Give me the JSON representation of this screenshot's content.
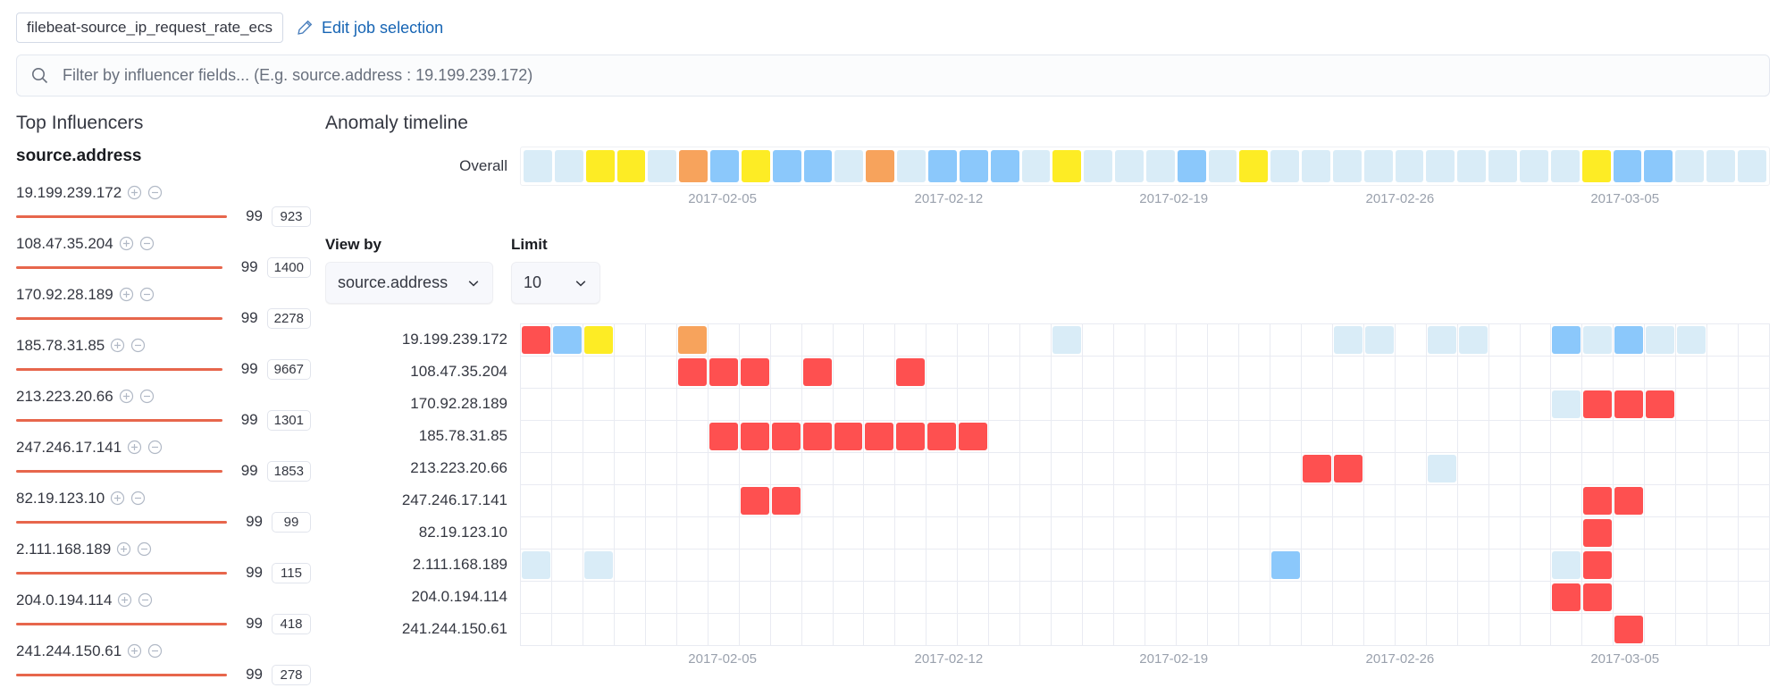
{
  "header": {
    "job_id": "filebeat-source_ip_request_rate_ecs",
    "edit_link": "Edit job selection",
    "pencil_icon": "pencil-icon"
  },
  "search": {
    "placeholder": "Filter by influencer fields... (E.g. source.address : 19.199.239.172)",
    "value": "",
    "icon": "search-icon"
  },
  "influencers_panel": {
    "title": "Top Influencers",
    "field_name": "source.address",
    "add_icon": "plus-circle-icon",
    "remove_icon": "minus-circle-icon",
    "bar_color": "#e7664c",
    "items": [
      {
        "name": "19.199.239.172",
        "score": "99",
        "bar_pct": 100,
        "count": "923"
      },
      {
        "name": "108.47.35.204",
        "score": "99",
        "bar_pct": 100,
        "count": "1400"
      },
      {
        "name": "170.92.28.189",
        "score": "99",
        "bar_pct": 100,
        "count": "2278"
      },
      {
        "name": "185.78.31.85",
        "score": "99",
        "bar_pct": 100,
        "count": "9667"
      },
      {
        "name": "213.223.20.66",
        "score": "99",
        "bar_pct": 100,
        "count": "1301"
      },
      {
        "name": "247.246.17.141",
        "score": "99",
        "bar_pct": 100,
        "count": "1853"
      },
      {
        "name": "82.19.123.10",
        "score": "99",
        "bar_pct": 100,
        "count": "99"
      },
      {
        "name": "2.111.168.189",
        "score": "99",
        "bar_pct": 100,
        "count": "115"
      },
      {
        "name": "204.0.194.114",
        "score": "99",
        "bar_pct": 100,
        "count": "418"
      },
      {
        "name": "241.244.150.61",
        "score": "99",
        "bar_pct": 100,
        "count": "278"
      }
    ]
  },
  "timeline_panel": {
    "title": "Anomaly timeline",
    "overall_label": "Overall"
  },
  "controls": {
    "view_by_label": "View by",
    "view_by_value": "source.address",
    "limit_label": "Limit",
    "limit_value": "10",
    "chevron_icon": "chevron-down-icon"
  },
  "severity_colors": {
    "none": "#ffffff",
    "low": "#d9ecf7",
    "warning": "#8bc8fb",
    "minor": "#fdec25",
    "major": "#f7a35c",
    "critical": "#fe5050"
  },
  "chart_data": {
    "type": "heatmap",
    "title": "Anomaly timeline",
    "xlabel": "",
    "ylabel": "source.address",
    "grid": true,
    "legend": "none",
    "axis_ticks": [
      {
        "label": "2017-02-05",
        "pct": 16.2
      },
      {
        "label": "2017-02-12",
        "pct": 34.3
      },
      {
        "label": "2017-02-19",
        "pct": 52.3
      },
      {
        "label": "2017-02-26",
        "pct": 70.4
      },
      {
        "label": "2017-03-05",
        "pct": 88.4
      }
    ],
    "overall": {
      "name": "Overall",
      "bins": 40,
      "severities": [
        "low",
        "low",
        "minor",
        "minor",
        "low",
        "major",
        "warning",
        "minor",
        "warning",
        "warning",
        "low",
        "major",
        "low",
        "warning",
        "warning",
        "warning",
        "low",
        "minor",
        "low",
        "low",
        "low",
        "warning",
        "low",
        "minor",
        "low",
        "low",
        "low",
        "low",
        "low",
        "low",
        "low",
        "low",
        "low",
        "low",
        "minor",
        "warning",
        "warning",
        "low",
        "low",
        "low"
      ]
    },
    "categories": [
      "19.199.239.172",
      "108.47.35.204",
      "170.92.28.189",
      "185.78.31.85",
      "213.223.20.66",
      "247.246.17.141",
      "82.19.123.10",
      "2.111.168.189",
      "204.0.194.114",
      "241.244.150.61"
    ],
    "bins": 40,
    "rows": [
      {
        "name": "19.199.239.172",
        "cells": [
          "critical",
          "warning",
          "minor",
          "none",
          "none",
          "major",
          "none",
          "none",
          "none",
          "none",
          "none",
          "none",
          "none",
          "none",
          "none",
          "none",
          "none",
          "low",
          "none",
          "none",
          "none",
          "none",
          "none",
          "none",
          "none",
          "none",
          "low",
          "low",
          "none",
          "low",
          "low",
          "none",
          "none",
          "warning",
          "low",
          "warning",
          "low",
          "low",
          "none",
          "none"
        ]
      },
      {
        "name": "108.47.35.204",
        "cells": [
          "none",
          "none",
          "none",
          "none",
          "none",
          "critical",
          "critical",
          "critical",
          "none",
          "critical",
          "none",
          "none",
          "critical",
          "none",
          "none",
          "none",
          "none",
          "none",
          "none",
          "none",
          "none",
          "none",
          "none",
          "none",
          "none",
          "none",
          "none",
          "none",
          "none",
          "none",
          "none",
          "none",
          "none",
          "none",
          "none",
          "none",
          "none",
          "none",
          "none",
          "none"
        ]
      },
      {
        "name": "170.92.28.189",
        "cells": [
          "none",
          "none",
          "none",
          "none",
          "none",
          "none",
          "none",
          "none",
          "none",
          "none",
          "none",
          "none",
          "none",
          "none",
          "none",
          "none",
          "none",
          "none",
          "none",
          "none",
          "none",
          "none",
          "none",
          "none",
          "none",
          "none",
          "none",
          "none",
          "none",
          "none",
          "none",
          "none",
          "none",
          "low",
          "critical",
          "critical",
          "critical",
          "none",
          "none",
          "none"
        ]
      },
      {
        "name": "185.78.31.85",
        "cells": [
          "none",
          "none",
          "none",
          "none",
          "none",
          "none",
          "critical",
          "critical",
          "critical",
          "critical",
          "critical",
          "critical",
          "critical",
          "critical",
          "critical",
          "none",
          "none",
          "none",
          "none",
          "none",
          "none",
          "none",
          "none",
          "none",
          "none",
          "none",
          "none",
          "none",
          "none",
          "none",
          "none",
          "none",
          "none",
          "none",
          "none",
          "none",
          "none",
          "none",
          "none",
          "none"
        ]
      },
      {
        "name": "213.223.20.66",
        "cells": [
          "none",
          "none",
          "none",
          "none",
          "none",
          "none",
          "none",
          "none",
          "none",
          "none",
          "none",
          "none",
          "none",
          "none",
          "none",
          "none",
          "none",
          "none",
          "none",
          "none",
          "none",
          "none",
          "none",
          "none",
          "none",
          "critical",
          "critical",
          "none",
          "none",
          "low",
          "none",
          "none",
          "none",
          "none",
          "none",
          "none",
          "none",
          "none",
          "none",
          "none"
        ]
      },
      {
        "name": "247.246.17.141",
        "cells": [
          "none",
          "none",
          "none",
          "none",
          "none",
          "none",
          "none",
          "critical",
          "critical",
          "none",
          "none",
          "none",
          "none",
          "none",
          "none",
          "none",
          "none",
          "none",
          "none",
          "none",
          "none",
          "none",
          "none",
          "none",
          "none",
          "none",
          "none",
          "none",
          "none",
          "none",
          "none",
          "none",
          "none",
          "none",
          "critical",
          "critical",
          "none",
          "none",
          "none",
          "none"
        ]
      },
      {
        "name": "82.19.123.10",
        "cells": [
          "none",
          "none",
          "none",
          "none",
          "none",
          "none",
          "none",
          "none",
          "none",
          "none",
          "none",
          "none",
          "none",
          "none",
          "none",
          "none",
          "none",
          "none",
          "none",
          "none",
          "none",
          "none",
          "none",
          "none",
          "none",
          "none",
          "none",
          "none",
          "none",
          "none",
          "none",
          "none",
          "none",
          "none",
          "critical",
          "none",
          "none",
          "none",
          "none",
          "none"
        ]
      },
      {
        "name": "2.111.168.189",
        "cells": [
          "low",
          "none",
          "low",
          "none",
          "none",
          "none",
          "none",
          "none",
          "none",
          "none",
          "none",
          "none",
          "none",
          "none",
          "none",
          "none",
          "none",
          "none",
          "none",
          "none",
          "none",
          "none",
          "none",
          "none",
          "warning",
          "none",
          "none",
          "none",
          "none",
          "none",
          "none",
          "none",
          "none",
          "low",
          "critical",
          "none",
          "none",
          "none",
          "none",
          "none"
        ]
      },
      {
        "name": "204.0.194.114",
        "cells": [
          "none",
          "none",
          "none",
          "none",
          "none",
          "none",
          "none",
          "none",
          "none",
          "none",
          "none",
          "none",
          "none",
          "none",
          "none",
          "none",
          "none",
          "none",
          "none",
          "none",
          "none",
          "none",
          "none",
          "none",
          "none",
          "none",
          "none",
          "none",
          "none",
          "none",
          "none",
          "none",
          "none",
          "critical",
          "critical",
          "none",
          "none",
          "none",
          "none",
          "none"
        ]
      },
      {
        "name": "241.244.150.61",
        "cells": [
          "none",
          "none",
          "none",
          "none",
          "none",
          "none",
          "none",
          "none",
          "none",
          "none",
          "none",
          "none",
          "none",
          "none",
          "none",
          "none",
          "none",
          "none",
          "none",
          "none",
          "none",
          "none",
          "none",
          "none",
          "none",
          "none",
          "none",
          "none",
          "none",
          "none",
          "none",
          "none",
          "none",
          "none",
          "none",
          "critical",
          "none",
          "none",
          "none",
          "none"
        ]
      }
    ]
  }
}
